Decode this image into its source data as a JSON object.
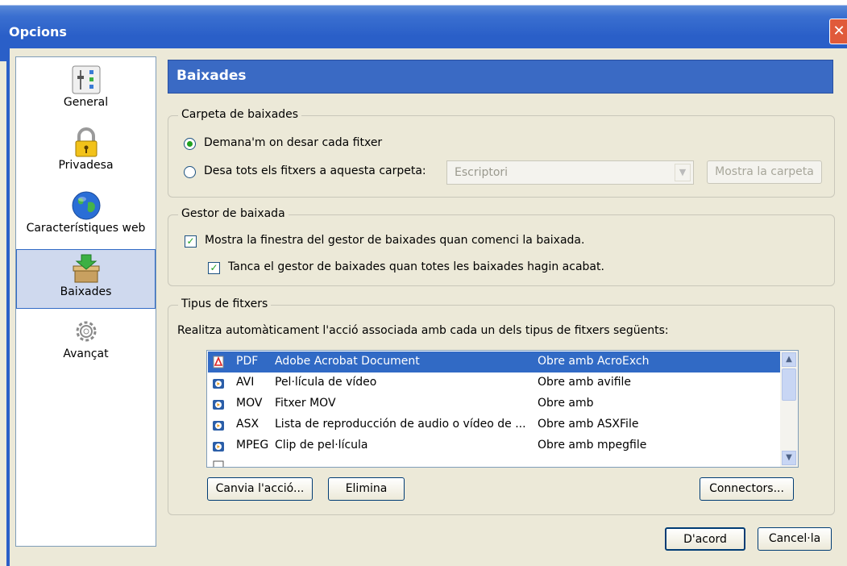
{
  "window": {
    "title": "Opcions",
    "close_glyph": "✕"
  },
  "sidebar": {
    "items": [
      {
        "label": "General",
        "icon": "sliders-icon"
      },
      {
        "label": "Privadesa",
        "icon": "padlock-icon"
      },
      {
        "label": "Característiques web",
        "icon": "globe-icon"
      },
      {
        "label": "Baixades",
        "icon": "download-box-icon",
        "selected": true
      },
      {
        "label": "Avançat",
        "icon": "gears-icon"
      }
    ]
  },
  "panel": {
    "title": "Baixades"
  },
  "download_folder": {
    "legend": "Carpeta de baixades",
    "option_ask": "Demana'm on desar cada fitxer",
    "option_save": "Desa tots els fitxers a aquesta carpeta:",
    "selected": "ask",
    "folder_value": "Escriptori",
    "show_folder_button": "Mostra la carpeta"
  },
  "download_manager": {
    "legend": "Gestor de baixada",
    "show_window": "Mostra la finestra del gestor de baixades quan comenci la baixada.",
    "show_window_checked": true,
    "close_when_done": "Tanca el gestor de baixades quan totes les baixades hagin acabat.",
    "close_when_done_checked": true
  },
  "file_types": {
    "legend": "Tipus de fitxers",
    "description": "Realitza automàticament l'acció associada amb cada un dels tipus de fitxers següents:",
    "rows": [
      {
        "ext": "PDF",
        "desc": "Adobe Acrobat Document",
        "action": "Obre amb AcroExch",
        "icon": "pdf-icon",
        "selected": true
      },
      {
        "ext": "AVI",
        "desc": "Pel·lícula de vídeo",
        "action": "Obre amb avifile",
        "icon": "media-file-icon"
      },
      {
        "ext": "MOV",
        "desc": "Fitxer MOV",
        "action": "Obre amb",
        "icon": "media-file-icon"
      },
      {
        "ext": "ASX",
        "desc": "Lista de reproducción de audio o vídeo de ...",
        "action": "Obre amb ASXFile",
        "icon": "media-file-icon"
      },
      {
        "ext": "MPEG",
        "desc": "Clip de pel·lícula",
        "action": "Obre amb mpegfile",
        "icon": "media-file-icon"
      }
    ],
    "change_action_button": "Canvia l'acció...",
    "remove_button": "Elimina",
    "plugins_button": "Connectors..."
  },
  "footer": {
    "ok_button": "D'acord",
    "cancel_button": "Cancel·la"
  },
  "colors": {
    "title_bar": "#2a5fc8",
    "header": "#3a6ac4",
    "selection": "#316ac5",
    "check_mark": "#21a121",
    "close_button": "#e05a3a"
  }
}
